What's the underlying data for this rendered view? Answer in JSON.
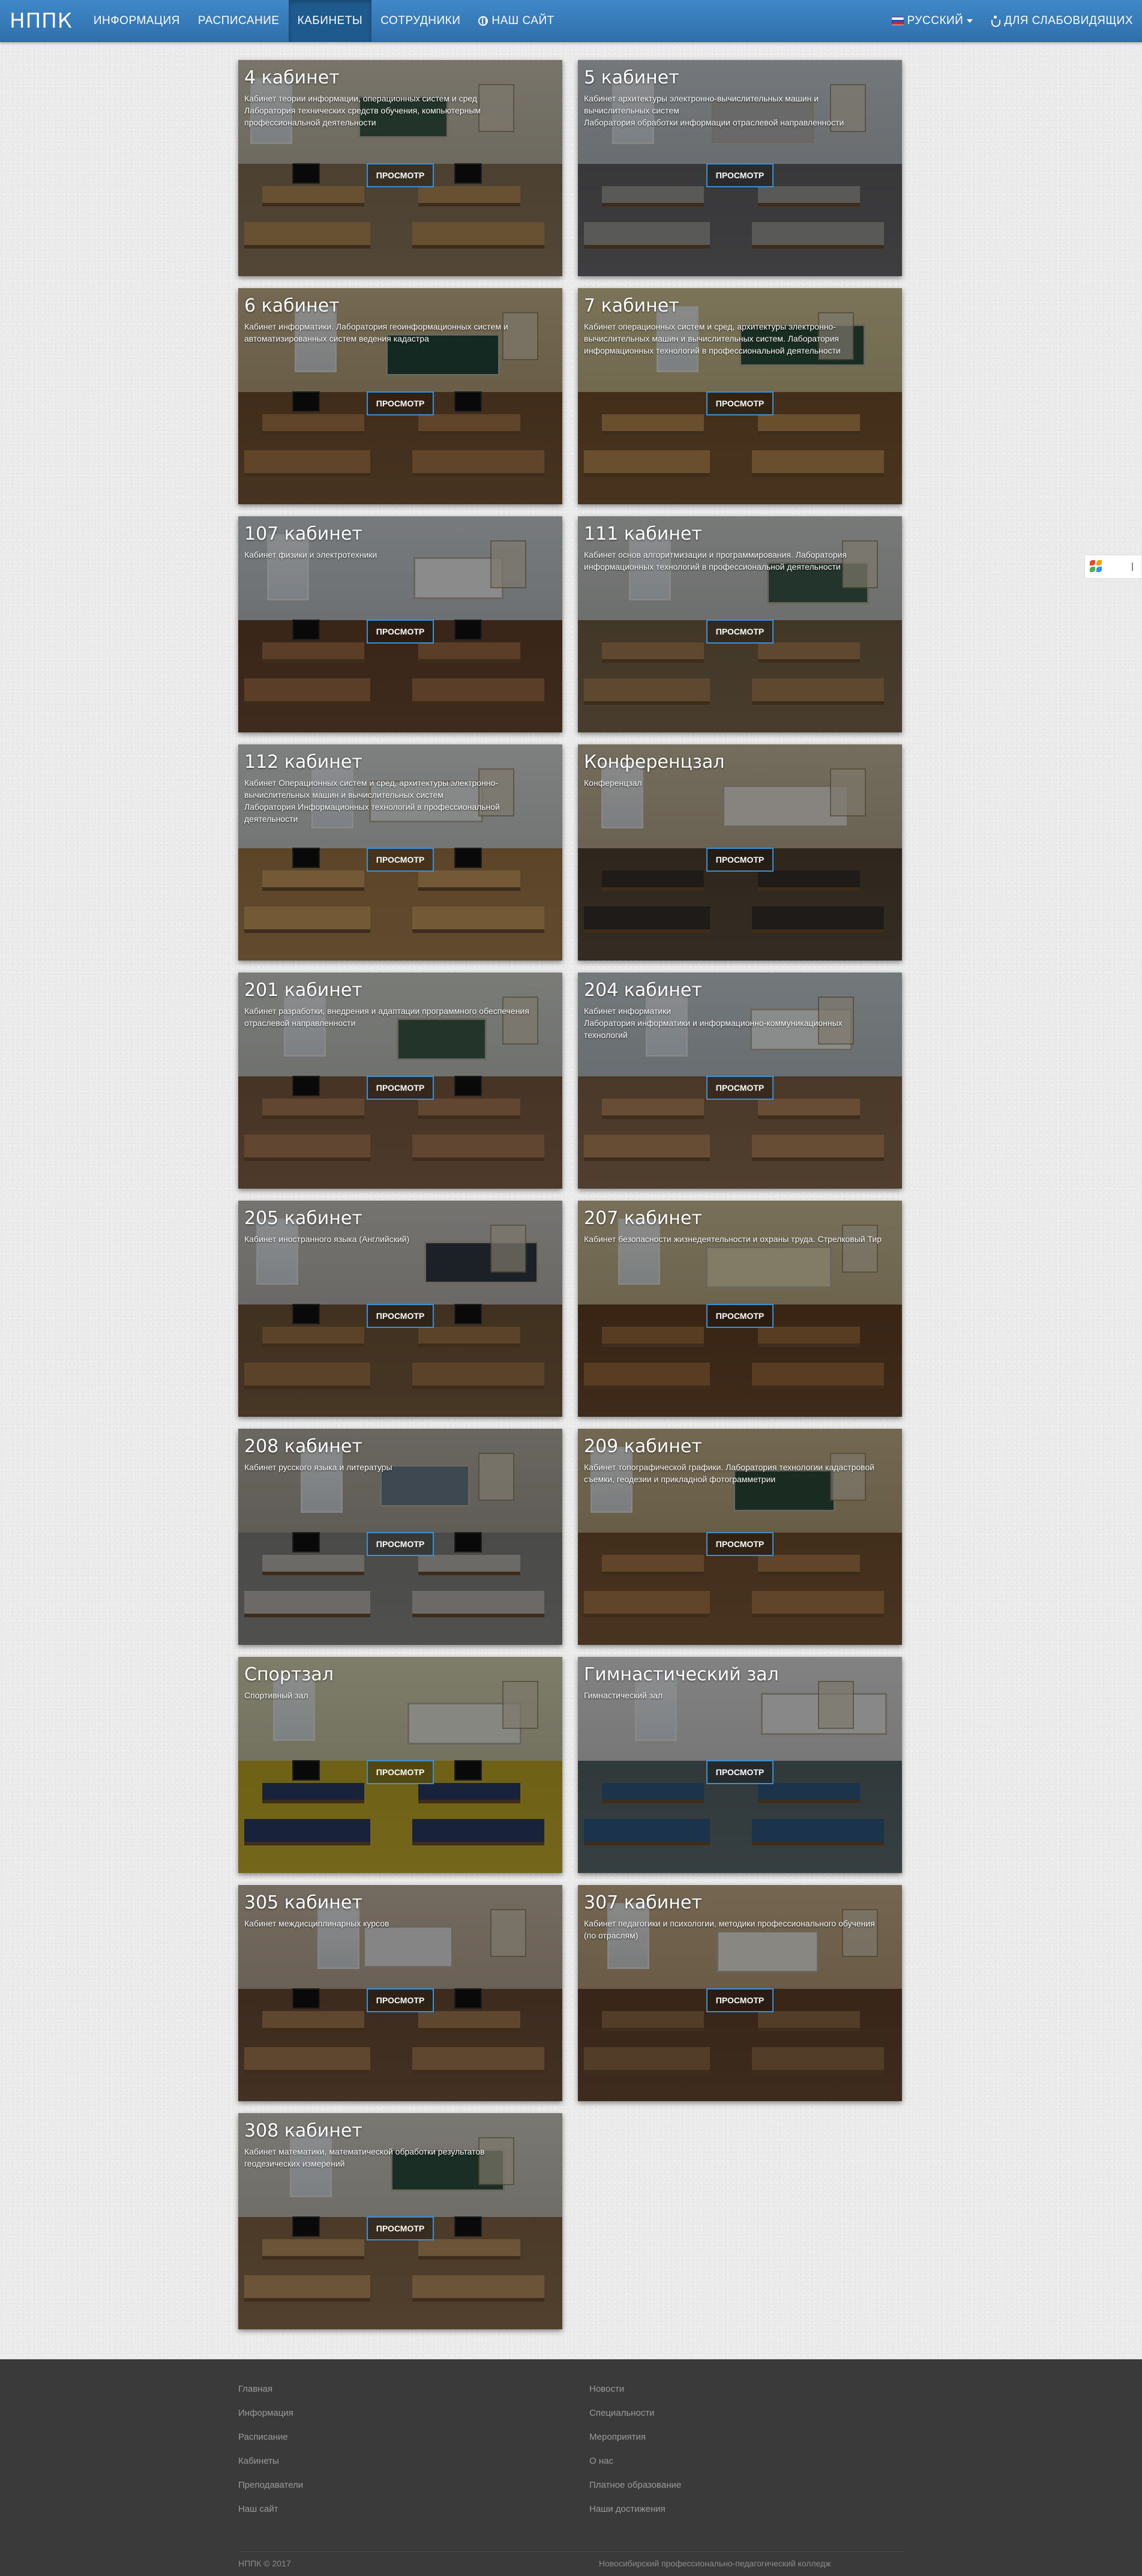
{
  "navbar": {
    "brand": "НППК",
    "menu": [
      {
        "label": "ИНФОРМАЦИЯ"
      },
      {
        "label": "РАСПИСАНИЕ"
      },
      {
        "label": "КАБИНЕТЫ"
      },
      {
        "label": "СОТРУДНИКИ"
      },
      {
        "label": "НАШ САЙТ"
      }
    ],
    "active": "КАБИНЕТЫ",
    "language": "РУССКИЙ",
    "accessibility": "ДЛЯ СЛАБОВИДЯЩИХ"
  },
  "view_button_label": "ПРОСМОТР",
  "rooms": [
    {
      "title": "4 кабинет",
      "desc": "Кабинет теории информации, операционных систем и сред\nЛаборатория технических средств обучения, компьютерным\nпрофессиональной деятельности"
    },
    {
      "title": "5 кабинет",
      "desc": "Кабинет архитектуры электронно-вычислительных машин и\nвычислительных систем\nЛаборатория обработки информации отраслевой направленности"
    },
    {
      "title": "6 кабинет",
      "desc": "Кабинет информатики. Лаборатория геоинформационных систем и\nавтоматизированных систем ведения кадастра"
    },
    {
      "title": "7 кабинет",
      "desc": "Кабинет операционных систем и сред, архитектуры электронно-\nвычислительных машин и вычислительных систем. Лаборатория\nинформационных технологий в профессиональной деятельности"
    },
    {
      "title": "107 кабинет",
      "desc": "Кабинет физики и электротехники"
    },
    {
      "title": "111 кабинет",
      "desc": "Кабинет основ алгоритмизации и программирования. Лаборатория\nинформационных технологий в профессиональной деятельности"
    },
    {
      "title": "112 кабинет",
      "desc": "Кабинет Операционных систем и сред, архитектуры электронно-\nвычислительных машин и вычислительных систем\nЛаборатория Информационных технологий в профессиональной\nдеятельности"
    },
    {
      "title": "Конференцзал",
      "desc": "Конференцзал"
    },
    {
      "title": "201 кабинет",
      "desc": "Кабинет разработки, внедрения и адаптации программного обеспечения\nотраслевой направленности"
    },
    {
      "title": "204 кабинет",
      "desc": "Кабинет информатики\nЛаборатория информатики и информационно-коммуникационных\nтехнологий"
    },
    {
      "title": "205 кабинет",
      "desc": "Кабинет иностранного языка (Английский)"
    },
    {
      "title": "207 кабинет",
      "desc": "Кабинет безопасности жизнедеятельности и охраны труда. Стрелковый Тир"
    },
    {
      "title": "208 кабинет",
      "desc": "Кабинет русского языка и литературы"
    },
    {
      "title": "209 кабинет",
      "desc": "Кабинет топографической графики. Лаборатория технологии кадастровой\nсъемки, геодезии и прикладной фотограмметрии"
    },
    {
      "title": "Спортзал",
      "desc": "Спортивный зал"
    },
    {
      "title": "Гимнастический зал",
      "desc": "Гимнастический зал"
    },
    {
      "title": "305 кабинет",
      "desc": "Кабинет междисциплинарных курсов"
    },
    {
      "title": "307 кабинет",
      "desc": "Кабинет педагогики и психологии, методики профессионального обучения\n(по отраслям)"
    },
    {
      "title": "308 кабинет",
      "desc": "Кабинет математики, математической обработки результатов\nгеодезических измерений"
    }
  ],
  "footer": {
    "col1": [
      "Главная",
      "Информация",
      "Расписание",
      "Кабинеты",
      "Преподаватели",
      "Наш сайт"
    ],
    "col2": [
      "Новости",
      "Специальности",
      "Мероприятия",
      "О нас",
      "Платное образование",
      "Наши достижения"
    ],
    "copyright": "НППК © 2017",
    "college": "Новосибирский профессионально-педагогический колледж"
  },
  "colors": {
    "navbar": "#3a7fc0",
    "active": "#1f5a8e",
    "button_border": "#3b8fd6",
    "footer": "#3a3a3a"
  }
}
